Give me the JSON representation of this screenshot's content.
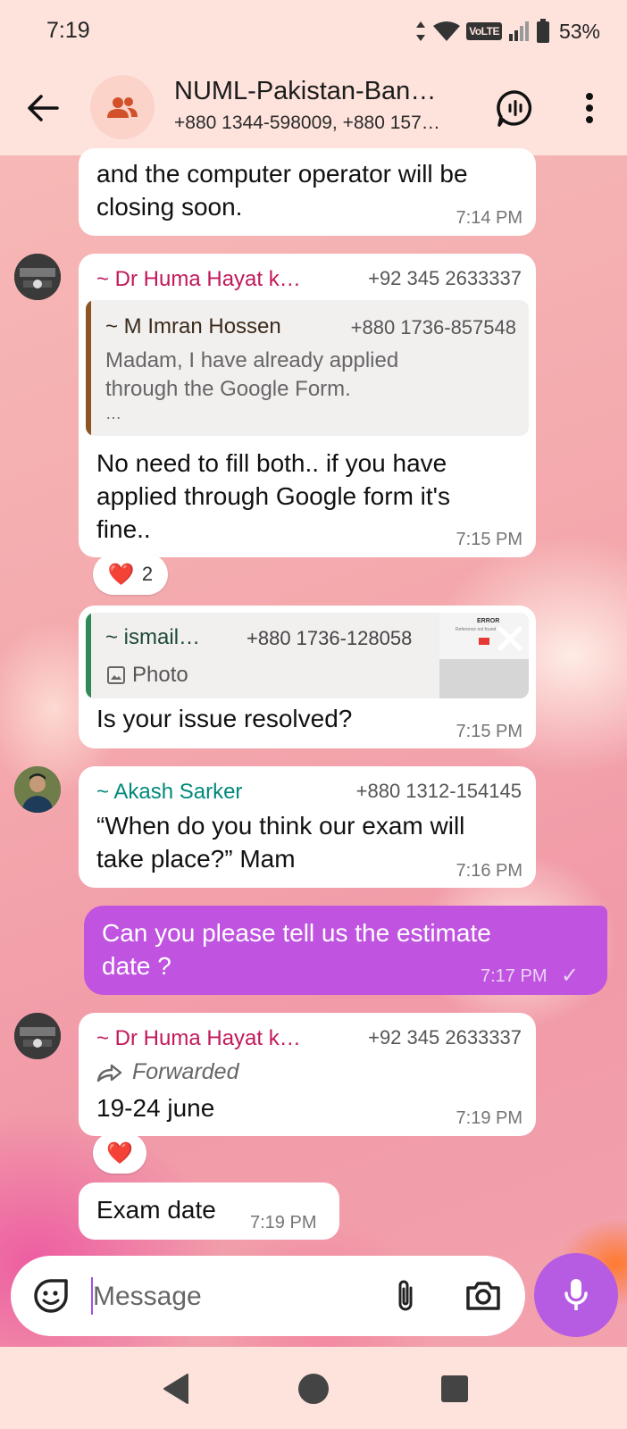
{
  "status_bar": {
    "time": "7:19",
    "network_badge": "VoLTE",
    "battery": "53%",
    "icons": [
      "data-arrows-icon",
      "wifi-icon",
      "signal-icon",
      "battery-icon"
    ]
  },
  "header": {
    "title": "NUML-Pakistan-Ban…",
    "subtitle": "+880 1344-598009, +880 157…",
    "icons": [
      "back-arrow-icon",
      "group-icon",
      "voice-chat-icon",
      "more-vert-icon"
    ]
  },
  "messages": [
    {
      "id": "m1",
      "direction": "incoming",
      "text_lines": [
        "and the computer operator will be",
        "closing soon."
      ],
      "time": "7:14 PM"
    },
    {
      "id": "m2",
      "direction": "incoming",
      "sender": "~ Dr Huma Hayat k…",
      "phone": "+92 345 2633337",
      "quote": {
        "sender": "~ M Imran Hossen",
        "phone": "+880 1736-857548",
        "text_lines": [
          "Madam, I have already applied",
          "through the Google Form."
        ],
        "more": "…"
      },
      "text_lines": [
        "No need to fill both.. if you have",
        "applied through Google form it's",
        "fine.."
      ],
      "time": "7:15 PM",
      "reaction": {
        "emoji": "❤️",
        "count": "2"
      }
    },
    {
      "id": "m3",
      "direction": "incoming",
      "quote": {
        "sender": "~ ismail…",
        "phone": "+880 1736-128058",
        "type": "Photo",
        "thumb_heading": "ERROR",
        "thumb_sub": "Reference not found"
      },
      "text": "Is your issue resolved?",
      "time": "7:15 PM"
    },
    {
      "id": "m4",
      "direction": "incoming",
      "sender": "~ Akash Sarker",
      "phone": "+880 1312-154145",
      "text_lines": [
        "“When do you think our exam will",
        "take place?” Mam"
      ],
      "time": "7:16 PM"
    },
    {
      "id": "m5",
      "direction": "outgoing",
      "text_lines": [
        "Can you please tell us the estimate",
        "date ?"
      ],
      "time": "7:17 PM",
      "status": "✓"
    },
    {
      "id": "m6",
      "direction": "incoming",
      "sender": "~ Dr Huma Hayat k…",
      "phone": "+92 345 2633337",
      "forwarded": "Forwarded",
      "text": "19-24 june",
      "time": "7:19 PM",
      "reaction": {
        "emoji": "❤️"
      }
    },
    {
      "id": "m7",
      "direction": "incoming",
      "text": "Exam date",
      "time": "7:19 PM"
    }
  ],
  "composer": {
    "placeholder": "Message",
    "icons": [
      "sticker-icon",
      "paperclip-icon",
      "camera-icon",
      "mic-icon"
    ]
  },
  "nav": {
    "icons": [
      "back-triangle-icon",
      "home-circle-icon",
      "recents-square-icon"
    ]
  },
  "colors": {
    "bar_bg": "#fde3dc",
    "accent": "#b55ce3",
    "outgoing_bubble": "#c054e0",
    "huma_name": "#c2185b",
    "imran_bar": "#8d5524",
    "ismail_bar": "#2e8b57",
    "akash_name": "#00897b"
  }
}
